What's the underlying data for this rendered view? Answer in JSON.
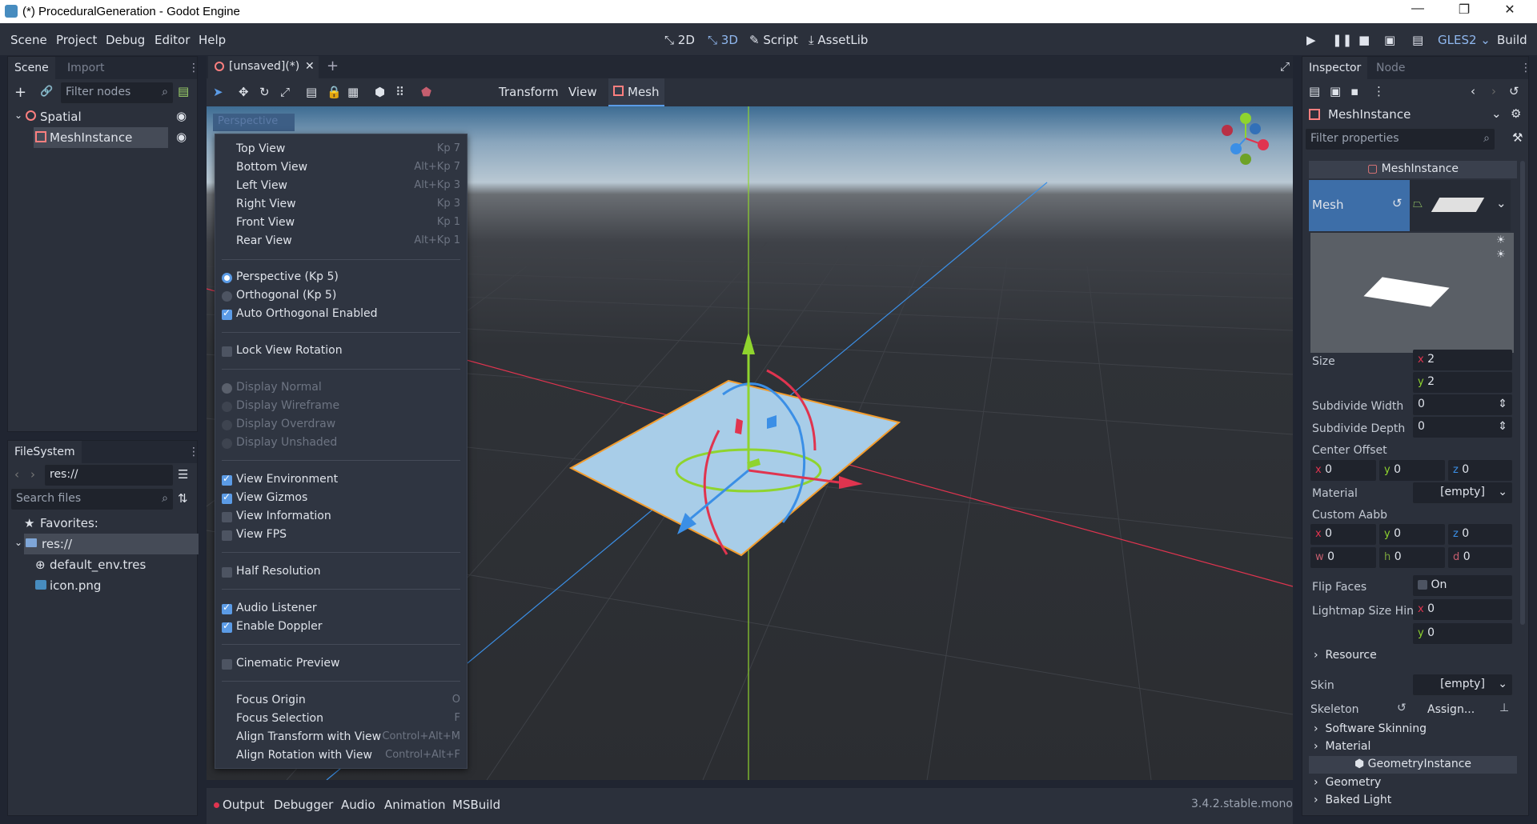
{
  "window": {
    "title": "(*) ProceduralGeneration - Godot Engine"
  },
  "menu": [
    "Scene",
    "Project",
    "Debug",
    "Editor",
    "Help"
  ],
  "workspaces": {
    "two_d": "2D",
    "three_d": "3D",
    "script": "Script",
    "assetlib": "AssetLib"
  },
  "top_right": {
    "renderer": "GLES2",
    "build": "Build"
  },
  "scene_dock": {
    "tabs": [
      "Scene",
      "Import"
    ],
    "filter_placeholder": "Filter nodes",
    "nodes": [
      "Spatial",
      "MeshInstance"
    ]
  },
  "filesystem": {
    "tab": "FileSystem",
    "path": "res://",
    "search_placeholder": "Search files",
    "favorites": "Favorites:",
    "items": [
      "res://",
      "default_env.tres",
      "icon.png"
    ]
  },
  "editor_tab": {
    "label": "[unsaved](*)"
  },
  "viewport_toolbar": {
    "transform": "Transform",
    "view": "View",
    "mesh": "Mesh"
  },
  "viewport_label": "Perspective",
  "popup": {
    "views": [
      {
        "label": "Top View",
        "shortcut": "Kp 7"
      },
      {
        "label": "Bottom View",
        "shortcut": "Alt+Kp 7"
      },
      {
        "label": "Left View",
        "shortcut": "Alt+Kp 3"
      },
      {
        "label": "Right View",
        "shortcut": "Kp 3"
      },
      {
        "label": "Front View",
        "shortcut": "Kp 1"
      },
      {
        "label": "Rear View",
        "shortcut": "Alt+Kp 1"
      }
    ],
    "perspective": "Perspective (Kp 5)",
    "orthogonal": "Orthogonal (Kp 5)",
    "auto_ortho": "Auto Orthogonal Enabled",
    "lock_rotation": "Lock View Rotation",
    "display": [
      "Display Normal",
      "Display Wireframe",
      "Display Overdraw",
      "Display Unshaded"
    ],
    "view_env": "View Environment",
    "view_gizmos": "View Gizmos",
    "view_info": "View Information",
    "view_fps": "View FPS",
    "half_res": "Half Resolution",
    "audio_listener": "Audio Listener",
    "doppler": "Enable Doppler",
    "cinematic": "Cinematic Preview",
    "focus_origin": "Focus Origin",
    "focus_origin_sc": "O",
    "focus_selection": "Focus Selection",
    "focus_selection_sc": "F",
    "align_transform": "Align Transform with View",
    "align_transform_sc": "Control+Alt+M",
    "align_rotation": "Align Rotation with View",
    "align_rotation_sc": "Control+Alt+F"
  },
  "bottom_panel": {
    "tabs": [
      "Output",
      "Debugger",
      "Audio",
      "Animation",
      "MSBuild"
    ],
    "version": "3.4.2.stable.mono"
  },
  "inspector": {
    "tabs": [
      "Inspector",
      "Node"
    ],
    "object": "MeshInstance",
    "filter_placeholder": "Filter properties",
    "section": "MeshInstance",
    "mesh_label": "Mesh",
    "size_label": "Size",
    "size_x": "2",
    "size_y": "2",
    "subdiv_w_label": "Subdivide Width",
    "subdiv_w": "0",
    "subdiv_d_label": "Subdivide Depth",
    "subdiv_d": "0",
    "center_offset_label": "Center Offset",
    "center_offset": {
      "x": "0",
      "y": "0",
      "z": "0"
    },
    "material_label": "Material",
    "material_value": "[empty]",
    "custom_aabb_label": "Custom Aabb",
    "aabb": {
      "x": "0",
      "y": "0",
      "z": "0",
      "w": "0",
      "h": "0",
      "d": "0"
    },
    "flip_faces_label": "Flip Faces",
    "flip_faces_value": "On",
    "lightmap_label": "Lightmap Size Hin",
    "lightmap": {
      "x": "0",
      "y": "0"
    },
    "resource_label": "Resource",
    "skin_label": "Skin",
    "skin_value": "[empty]",
    "skeleton_label": "Skeleton",
    "skeleton_value": "Assign...",
    "software_skinning": "Software Skinning",
    "material_section": "Material",
    "geometry_instance": "GeometryInstance",
    "geometry": "Geometry",
    "baked_light": "Baked Light",
    "axis_letters": {
      "x": "x",
      "y": "y",
      "z": "z",
      "w": "w",
      "h": "h",
      "d": "d"
    }
  },
  "colors": {
    "accent": "#5b9be6",
    "axis_x": "#e0344f",
    "axis_y": "#8fd42e",
    "axis_z": "#3b8fe6",
    "selection": "#f39c2c"
  }
}
